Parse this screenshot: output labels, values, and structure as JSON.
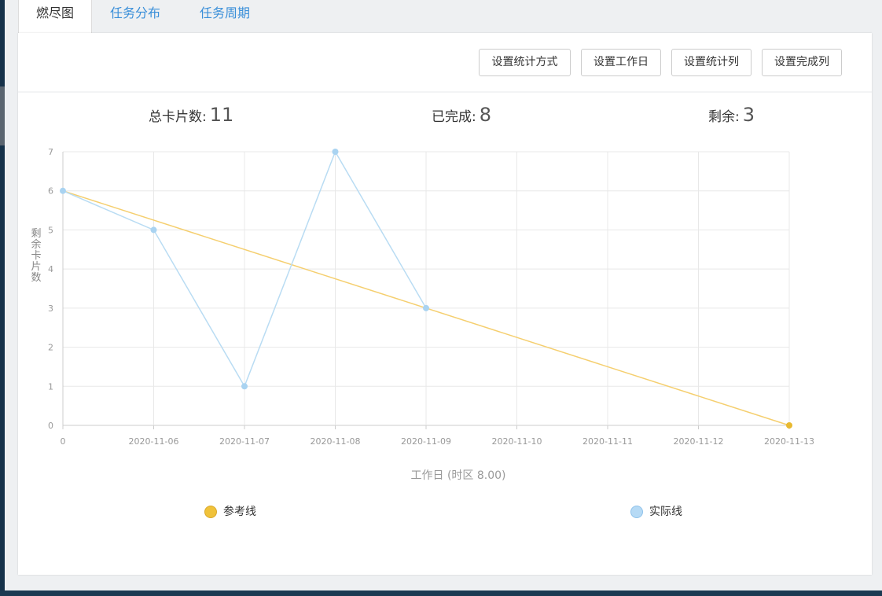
{
  "tabs": [
    {
      "label": "燃尽图",
      "active": true
    },
    {
      "label": "任务分布",
      "active": false
    },
    {
      "label": "任务周期",
      "active": false
    }
  ],
  "toolbar": {
    "buttons": [
      "设置统计方式",
      "设置工作日",
      "设置统计列",
      "设置完成列"
    ]
  },
  "stats": {
    "total_label": "总卡片数:",
    "total_value": "11",
    "done_label": "已完成:",
    "done_value": "8",
    "remaining_label": "剩余:",
    "remaining_value": "3"
  },
  "colors": {
    "reference": "#f5cf6f",
    "reference_point": "#e8b930",
    "actual": "#b9dcf3",
    "actual_point": "#a9d3f1",
    "tab_link": "#3a8fd9"
  },
  "chart_data": {
    "type": "line",
    "categories": [
      "0",
      "2020-11-06",
      "2020-11-07",
      "2020-11-08",
      "2020-11-09",
      "2020-11-10",
      "2020-11-11",
      "2020-11-12",
      "2020-11-13"
    ],
    "ylabel": "剩余卡片数",
    "xlabel": "工作日 (时区 8.00)",
    "ylim": [
      0,
      7
    ],
    "yticks": [
      0,
      1,
      2,
      3,
      4,
      5,
      6,
      7
    ],
    "grid": true,
    "legend_position": "bottom",
    "series": [
      {
        "name": "参考线",
        "values": [
          6,
          null,
          null,
          null,
          null,
          null,
          null,
          null,
          0
        ],
        "line": "straight"
      },
      {
        "name": "实际线",
        "values": [
          6,
          5,
          1,
          7,
          3,
          null,
          null,
          null,
          null
        ]
      }
    ]
  }
}
